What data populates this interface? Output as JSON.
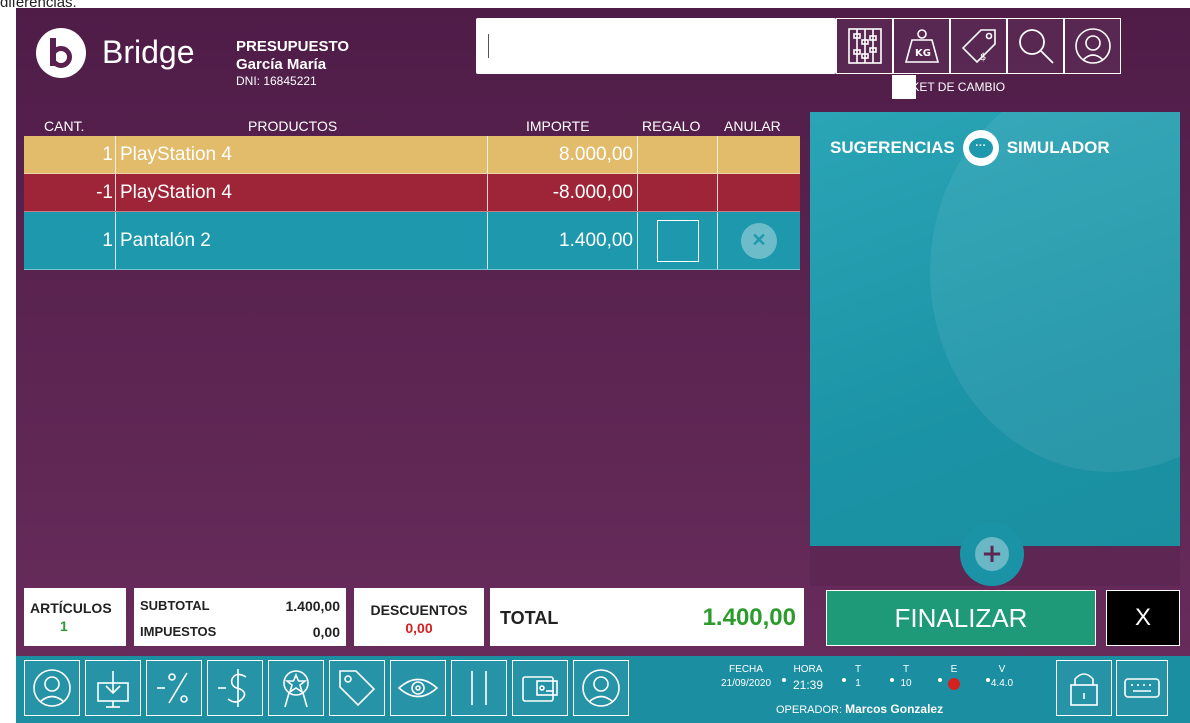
{
  "caption": "diferencias.",
  "brand": {
    "name": "Bridge"
  },
  "client": {
    "doc_type": "PRESUPUESTO",
    "name": "García María",
    "dni": "DNI: 16845221"
  },
  "search": {
    "value": ""
  },
  "tools": [
    "abacus-icon",
    "weight-kg-icon",
    "price-tag-icon",
    "search-icon",
    "agent-face-icon"
  ],
  "ticket_cambio": {
    "label": "TICKET DE CAMBIO"
  },
  "table": {
    "headers": {
      "cant": "CANT.",
      "productos": "PRODUCTOS",
      "importe": "IMPORTE",
      "regalo": "REGALO",
      "anular": "ANULAR"
    },
    "rows": [
      {
        "cant": "1",
        "producto": "PlayStation 4",
        "importe": "8.000,00",
        "color": "#e3bc6b"
      },
      {
        "cant": "-1",
        "producto": "PlayStation 4",
        "importe": "-8.000,00",
        "color": "#9e2538"
      },
      {
        "cant": "1",
        "producto": "Pantalón 2",
        "importe": "1.400,00",
        "color": "#1e98ad"
      }
    ]
  },
  "panel": {
    "sugerencias": "SUGERENCIAS",
    "simulador": "SIMULADOR"
  },
  "totals": {
    "articulos_label": "ARTÍCULOS",
    "articulos_value": "1",
    "subtotal_label": "SUBTOTAL",
    "subtotal_value": "1.400,00",
    "impuestos_label": "IMPUESTOS",
    "impuestos_value": "0,00",
    "descuentos_label": "DESCUENTOS",
    "descuentos_value": "0,00",
    "total_label": "TOTAL",
    "total_value": "1.400,00"
  },
  "actions": {
    "finalizar": "FINALIZAR",
    "close": "X"
  },
  "status": {
    "fecha_label": "FECHA",
    "fecha": "21/09/2020",
    "hora_label": "HORA",
    "hora": "21:39",
    "t1_label": "T",
    "t1": "1",
    "t2_label": "T",
    "t2": "10",
    "e_label": "E",
    "v_label": "V",
    "v": "4.4.0",
    "operator_label": "OPERADOR:",
    "operator": "Marcos Gonzalez"
  },
  "colors": {
    "accent": "#1e98ad",
    "background": "#5e2653",
    "green": "#2b9b2b",
    "red": "#d42020"
  }
}
